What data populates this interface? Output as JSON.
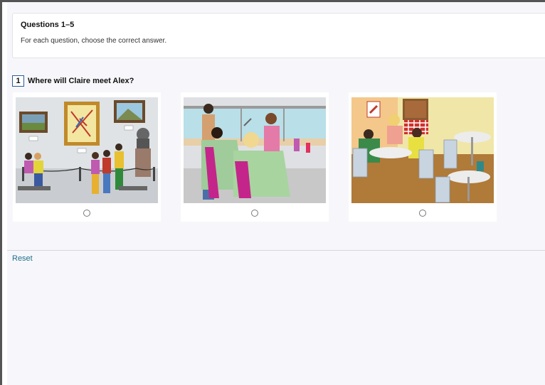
{
  "instructions": {
    "title": "Questions 1–5",
    "text": "For each question, choose the correct answer."
  },
  "question": {
    "number": "1",
    "text": "Where will Claire meet Alex?"
  },
  "options": [
    {
      "scene": "art-gallery",
      "selected": false
    },
    {
      "scene": "hair-salon",
      "selected": false
    },
    {
      "scene": "cafe",
      "selected": false
    }
  ],
  "reset_label": "Reset",
  "colors": {
    "link": "#1f6f8b",
    "question_border": "#2b5a9a"
  }
}
